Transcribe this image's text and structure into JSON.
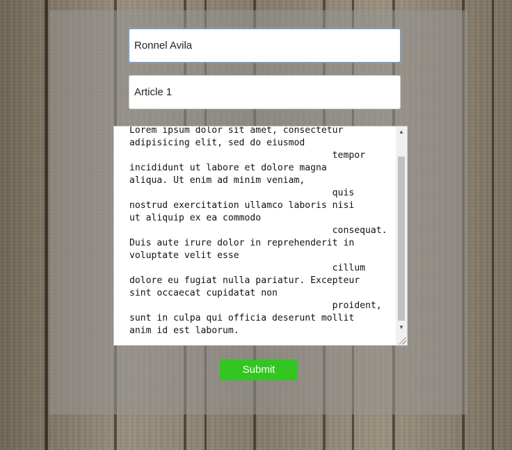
{
  "form": {
    "name_value": "Ronnel Avila",
    "title_value": "Article 1",
    "body_text": "Lorem ipsum dolor sit amet, consectetur\nadipisicing elit, sed do eiusmod\n                                     tempor\nincididunt ut labore et dolore magna\naliqua. Ut enim ad minim veniam,\n                                     quis\nnostrud exercitation ullamco laboris nisi\nut aliquip ex ea commodo\n                                     consequat.\nDuis aute irure dolor in reprehenderit in\nvoluptate velit esse\n                                     cillum\ndolore eu fugiat nulla pariatur. Excepteur\nsint occaecat cupidatat non\n                                     proident,\nsunt in culpa qui officia deserunt mollit\nanim id est laborum.",
    "submit_label": "Submit"
  },
  "icons": {
    "scroll_up": "scroll-up-arrow-icon",
    "scroll_down": "scroll-down-arrow-icon",
    "resize": "resize-grip-icon"
  },
  "colors": {
    "submit_bg": "#33c522",
    "focus_border": "#6d9bd1",
    "panel_overlay": "rgba(150,150,150,0.55)"
  }
}
